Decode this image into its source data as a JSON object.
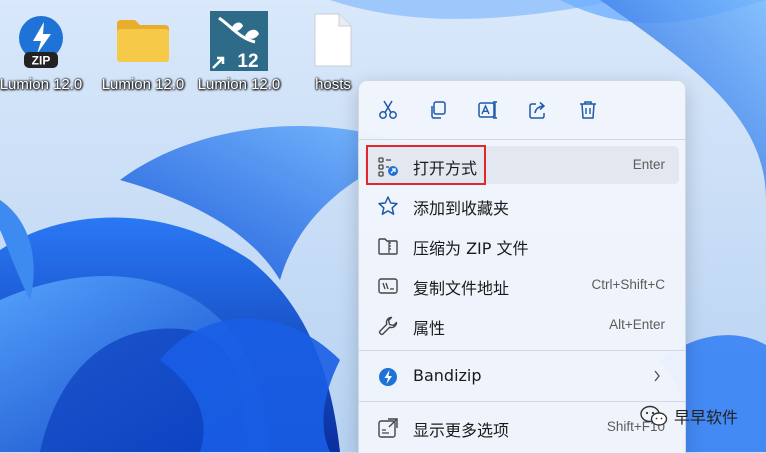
{
  "desktop": {
    "icons": [
      {
        "label": "Lumion 12.0",
        "icon": "bandizip-zip-icon",
        "badge": "ZIP"
      },
      {
        "label": "Lumion 12.0",
        "icon": "folder-icon"
      },
      {
        "label": "Lumion 12.0",
        "icon": "lumion-shortcut-icon",
        "badge": "12"
      },
      {
        "label": "hosts",
        "icon": "file-icon"
      }
    ]
  },
  "context_menu": {
    "quick_actions": [
      "cut-icon",
      "copy-icon",
      "rename-icon",
      "share-icon",
      "delete-icon"
    ],
    "items": [
      {
        "label": "打开方式",
        "shortcut": "Enter",
        "icon": "open-with-icon",
        "highlighted": true
      },
      {
        "label": "添加到收藏夹",
        "shortcut": "",
        "icon": "star-icon"
      },
      {
        "label": "压缩为 ZIP 文件",
        "shortcut": "",
        "icon": "zip-folder-icon"
      },
      {
        "label": "复制文件地址",
        "shortcut": "Ctrl+Shift+C",
        "icon": "copy-path-icon"
      },
      {
        "label": "属性",
        "shortcut": "Alt+Enter",
        "icon": "wrench-icon"
      },
      {
        "label": "Bandizip",
        "shortcut": "",
        "icon": "bandizip-icon",
        "submenu": true
      },
      {
        "label": "显示更多选项",
        "shortcut": "Shift+F10",
        "icon": "more-options-icon"
      }
    ]
  },
  "watermark": {
    "text": "早早软件"
  },
  "colors": {
    "accent": "#0067c0",
    "highlight_border": "#e2262c",
    "folder": "#f7c948",
    "bandizip": "#1f73d6",
    "lumion": "#2d6b88"
  }
}
